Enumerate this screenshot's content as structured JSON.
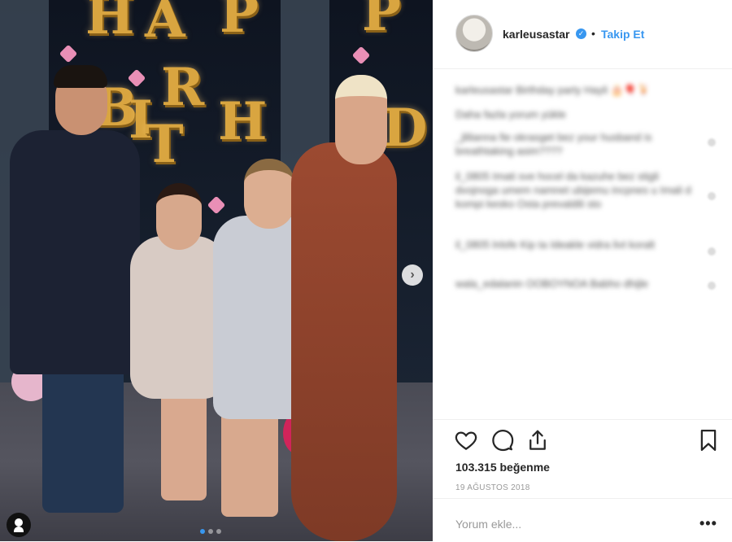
{
  "photo": {
    "balloon_letters": [
      "H",
      "A",
      "P",
      "P",
      "B",
      "I",
      "R",
      "T",
      "H",
      "D"
    ],
    "carousel_dots": [
      true,
      false,
      false
    ],
    "next_icon": "chevron-right-icon"
  },
  "header": {
    "username": "karleusastar",
    "verified_icon": "verified-badge-icon",
    "separator": "•",
    "follow_label": "Takip Et"
  },
  "comments": {
    "caption": "karleusastar Birthday party Hayli 🎂🎈🍹",
    "caption_sub": "Daha fazla yorum yükle",
    "items": [
      "_jlilianna fie okrasget bez your husband is breathtaking asim????",
      "il_0805 Imati sve hocel da kazuhe bez stigli dvojnoga umem namnet ubijemu incpnes u Imali d kompi kesko Osta prevaldili sto",
      "il_0805 lnlsfe Kip ta Ideakle vidra livt koralt",
      "wala_edalanin OOBOYNOA Babho dhijle"
    ]
  },
  "actions": {
    "like_icon": "heart-icon",
    "comment_icon": "comment-icon",
    "share_icon": "share-icon",
    "save_icon": "bookmark-icon"
  },
  "likes": "103.315 beğenme",
  "date": "19 AĞUSTOS 2018",
  "comment_box": {
    "placeholder": "Yorum ekle...",
    "more_label": "•••"
  }
}
